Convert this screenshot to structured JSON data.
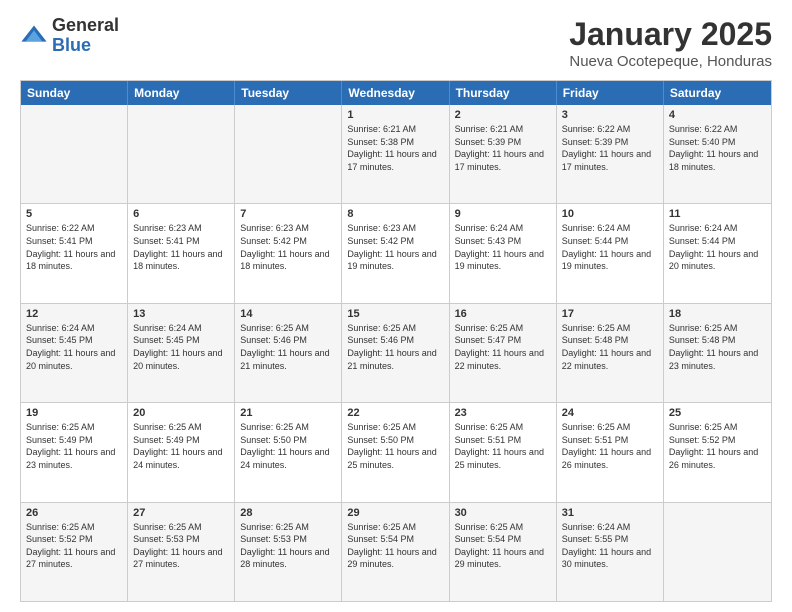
{
  "logo": {
    "general": "General",
    "blue": "Blue"
  },
  "header": {
    "month": "January 2025",
    "location": "Nueva Ocotepeque, Honduras"
  },
  "days": [
    "Sunday",
    "Monday",
    "Tuesday",
    "Wednesday",
    "Thursday",
    "Friday",
    "Saturday"
  ],
  "weeks": [
    [
      {
        "day": "",
        "info": ""
      },
      {
        "day": "",
        "info": ""
      },
      {
        "day": "",
        "info": ""
      },
      {
        "day": "1",
        "info": "Sunrise: 6:21 AM\nSunset: 5:38 PM\nDaylight: 11 hours and 17 minutes."
      },
      {
        "day": "2",
        "info": "Sunrise: 6:21 AM\nSunset: 5:39 PM\nDaylight: 11 hours and 17 minutes."
      },
      {
        "day": "3",
        "info": "Sunrise: 6:22 AM\nSunset: 5:39 PM\nDaylight: 11 hours and 17 minutes."
      },
      {
        "day": "4",
        "info": "Sunrise: 6:22 AM\nSunset: 5:40 PM\nDaylight: 11 hours and 18 minutes."
      }
    ],
    [
      {
        "day": "5",
        "info": "Sunrise: 6:22 AM\nSunset: 5:41 PM\nDaylight: 11 hours and 18 minutes."
      },
      {
        "day": "6",
        "info": "Sunrise: 6:23 AM\nSunset: 5:41 PM\nDaylight: 11 hours and 18 minutes."
      },
      {
        "day": "7",
        "info": "Sunrise: 6:23 AM\nSunset: 5:42 PM\nDaylight: 11 hours and 18 minutes."
      },
      {
        "day": "8",
        "info": "Sunrise: 6:23 AM\nSunset: 5:42 PM\nDaylight: 11 hours and 19 minutes."
      },
      {
        "day": "9",
        "info": "Sunrise: 6:24 AM\nSunset: 5:43 PM\nDaylight: 11 hours and 19 minutes."
      },
      {
        "day": "10",
        "info": "Sunrise: 6:24 AM\nSunset: 5:44 PM\nDaylight: 11 hours and 19 minutes."
      },
      {
        "day": "11",
        "info": "Sunrise: 6:24 AM\nSunset: 5:44 PM\nDaylight: 11 hours and 20 minutes."
      }
    ],
    [
      {
        "day": "12",
        "info": "Sunrise: 6:24 AM\nSunset: 5:45 PM\nDaylight: 11 hours and 20 minutes."
      },
      {
        "day": "13",
        "info": "Sunrise: 6:24 AM\nSunset: 5:45 PM\nDaylight: 11 hours and 20 minutes."
      },
      {
        "day": "14",
        "info": "Sunrise: 6:25 AM\nSunset: 5:46 PM\nDaylight: 11 hours and 21 minutes."
      },
      {
        "day": "15",
        "info": "Sunrise: 6:25 AM\nSunset: 5:46 PM\nDaylight: 11 hours and 21 minutes."
      },
      {
        "day": "16",
        "info": "Sunrise: 6:25 AM\nSunset: 5:47 PM\nDaylight: 11 hours and 22 minutes."
      },
      {
        "day": "17",
        "info": "Sunrise: 6:25 AM\nSunset: 5:48 PM\nDaylight: 11 hours and 22 minutes."
      },
      {
        "day": "18",
        "info": "Sunrise: 6:25 AM\nSunset: 5:48 PM\nDaylight: 11 hours and 23 minutes."
      }
    ],
    [
      {
        "day": "19",
        "info": "Sunrise: 6:25 AM\nSunset: 5:49 PM\nDaylight: 11 hours and 23 minutes."
      },
      {
        "day": "20",
        "info": "Sunrise: 6:25 AM\nSunset: 5:49 PM\nDaylight: 11 hours and 24 minutes."
      },
      {
        "day": "21",
        "info": "Sunrise: 6:25 AM\nSunset: 5:50 PM\nDaylight: 11 hours and 24 minutes."
      },
      {
        "day": "22",
        "info": "Sunrise: 6:25 AM\nSunset: 5:50 PM\nDaylight: 11 hours and 25 minutes."
      },
      {
        "day": "23",
        "info": "Sunrise: 6:25 AM\nSunset: 5:51 PM\nDaylight: 11 hours and 25 minutes."
      },
      {
        "day": "24",
        "info": "Sunrise: 6:25 AM\nSunset: 5:51 PM\nDaylight: 11 hours and 26 minutes."
      },
      {
        "day": "25",
        "info": "Sunrise: 6:25 AM\nSunset: 5:52 PM\nDaylight: 11 hours and 26 minutes."
      }
    ],
    [
      {
        "day": "26",
        "info": "Sunrise: 6:25 AM\nSunset: 5:52 PM\nDaylight: 11 hours and 27 minutes."
      },
      {
        "day": "27",
        "info": "Sunrise: 6:25 AM\nSunset: 5:53 PM\nDaylight: 11 hours and 27 minutes."
      },
      {
        "day": "28",
        "info": "Sunrise: 6:25 AM\nSunset: 5:53 PM\nDaylight: 11 hours and 28 minutes."
      },
      {
        "day": "29",
        "info": "Sunrise: 6:25 AM\nSunset: 5:54 PM\nDaylight: 11 hours and 29 minutes."
      },
      {
        "day": "30",
        "info": "Sunrise: 6:25 AM\nSunset: 5:54 PM\nDaylight: 11 hours and 29 minutes."
      },
      {
        "day": "31",
        "info": "Sunrise: 6:24 AM\nSunset: 5:55 PM\nDaylight: 11 hours and 30 minutes."
      },
      {
        "day": "",
        "info": ""
      }
    ]
  ]
}
